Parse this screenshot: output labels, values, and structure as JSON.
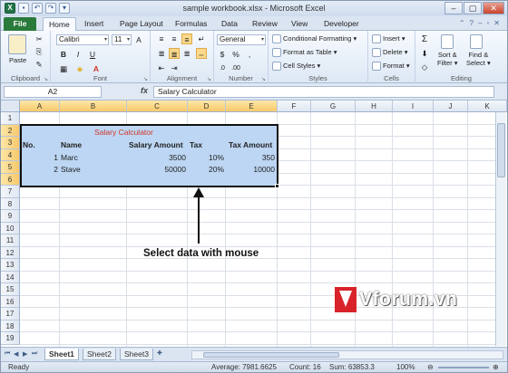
{
  "window": {
    "title": "sample workbook.xlsx - Microsoft Excel",
    "controls": [
      "–",
      "▢",
      "✕"
    ]
  },
  "ribbon": {
    "file_tab": "File",
    "tabs": [
      "Home",
      "Insert",
      "Page Layout",
      "Formulas",
      "Data",
      "Review",
      "View",
      "Developer"
    ],
    "clipboard": {
      "label": "Clipboard",
      "paste": "Paste"
    },
    "font": {
      "label": "Font",
      "name": "Calibri",
      "size": "11"
    },
    "alignment": {
      "label": "Alignment"
    },
    "number": {
      "label": "Number",
      "format": "General"
    },
    "styles": {
      "label": "Styles",
      "conditional": "Conditional Formatting",
      "table": "Format as Table",
      "cell": "Cell Styles"
    },
    "cells": {
      "label": "Cells",
      "insert": "Insert",
      "delete": "Delete",
      "format": "Format"
    },
    "editing": {
      "label": "Editing",
      "sort": "Sort &",
      "sort2": "Filter",
      "find": "Find &",
      "find2": "Select"
    }
  },
  "formula_bar": {
    "name_box": "A2",
    "fx": "fx",
    "content": "Salary Calculator"
  },
  "grid": {
    "columns": [
      "A",
      "B",
      "C",
      "D",
      "E",
      "F",
      "G",
      "H",
      "I",
      "J",
      "K"
    ],
    "rows": [
      "1",
      "2",
      "3",
      "4",
      "5",
      "6",
      "7",
      "8",
      "9",
      "10",
      "11",
      "12",
      "13",
      "14",
      "15",
      "16",
      "17",
      "18",
      "19"
    ],
    "title": "Salary Calculator",
    "headers": [
      "No.",
      "Name",
      "Salary Amount",
      "Tax",
      "Tax Amount"
    ],
    "data": [
      [
        "1",
        "Marc",
        "3500",
        "10%",
        "350"
      ],
      [
        "2",
        "Stave",
        "50000",
        "20%",
        "10000"
      ]
    ]
  },
  "annotation": "Select data with mouse",
  "watermark": "Vforum.vn",
  "sheets": [
    "Sheet1",
    "Sheet2",
    "Sheet3"
  ],
  "status": {
    "mode": "Ready",
    "average": "Average: 7981.6625",
    "count": "Count: 16",
    "sum": "Sum: 63853.3",
    "zoom": "100%"
  },
  "colors": {
    "file_tab": "#2a7a3b",
    "selection_fill": "#bcd6f3",
    "title_red": "#d3362a"
  }
}
